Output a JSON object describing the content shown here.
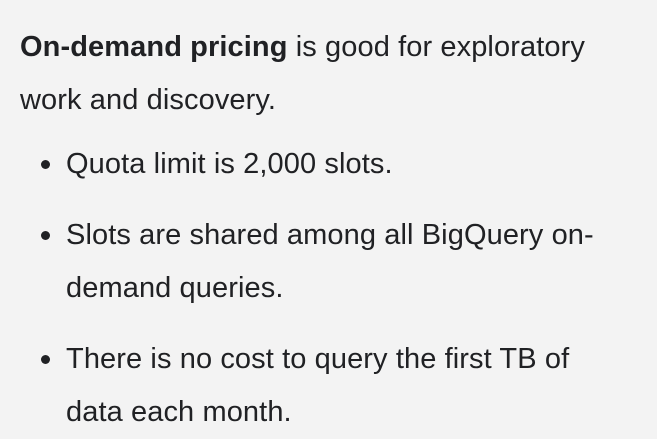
{
  "intro": {
    "bold": "On-demand pricing",
    "rest": " is good for exploratory work and discovery."
  },
  "bullets": [
    {
      "text": "Quota limit is 2,000 slots."
    },
    {
      "text": "Slots are shared among all BigQuery on-demand queries."
    },
    {
      "text": "There is no cost to query the first TB of data each month."
    }
  ]
}
